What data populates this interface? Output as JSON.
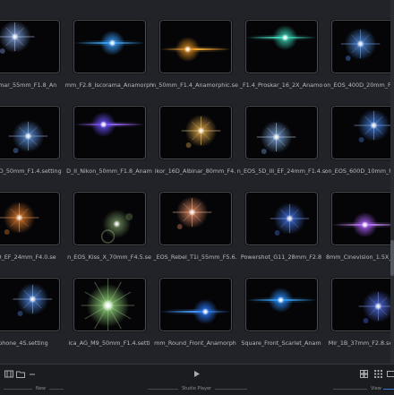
{
  "tiles": [
    {
      "caption": "ikumar_55mm_F1.8_An",
      "flare": {
        "type": "star",
        "color": "#ffffff",
        "glow": "#8fb8ff",
        "streak": "#c9d8ff"
      }
    },
    {
      "caption": "mm_F2.8_Iscorama_Anamorph",
      "flare": {
        "type": "streak",
        "color": "#d8f0ff",
        "glow": "#3aa0ff",
        "streak": "#37a8ff"
      }
    },
    {
      "caption": "n_50mm_F1.4_Anamorphic.se",
      "flare": {
        "type": "streak",
        "color": "#ffe6b0",
        "glow": "#d88a20",
        "streak": "#ffb03a"
      }
    },
    {
      "caption": "_F1.4_Proskar_16_2X_Anamo",
      "flare": {
        "type": "streak",
        "color": "#e9fff6",
        "glow": "#3ad8b8",
        "streak": "#47e0c8"
      }
    },
    {
      "caption": "on_EOS_400D_20mm_F2.8.set",
      "flare": {
        "type": "star",
        "color": "#ffffff",
        "glow": "#5aa0ff",
        "streak": "#7ab8ff"
      }
    },
    {
      "caption": "n_50D_50mm_F1.4.setting",
      "flare": {
        "type": "star",
        "color": "#ffffff",
        "glow": "#6aa8ff",
        "streak": "#a0c8ff"
      }
    },
    {
      "caption": "D_II_Nikon_50mm_F1.8_Anam",
      "flare": {
        "type": "streak",
        "color": "#f0e8ff",
        "glow": "#6a50ff",
        "streak": "#a06aff"
      }
    },
    {
      "caption": "ikor_16D_Albinar_80mm_F4.",
      "flare": {
        "type": "star",
        "color": "#fff6d0",
        "glow": "#ffbe50",
        "streak": "#ffd890"
      }
    },
    {
      "caption": "n_EOS_5D_III_EF_24mm_F1.4.s",
      "flare": {
        "type": "star",
        "color": "#ffffff",
        "glow": "#8cc0ff",
        "streak": "#d8e8ff"
      }
    },
    {
      "caption": "on_EOS_600D_10mm_F8.0.se",
      "flare": {
        "type": "star",
        "color": "#ffffff",
        "glow": "#4a90ff",
        "streak": "#a0c0ff"
      }
    },
    {
      "caption": "_7D_EF_24mm_F4.0.se",
      "flare": {
        "type": "star",
        "color": "#ffe0b0",
        "glow": "#ff8a30",
        "streak": "#ffb070"
      }
    },
    {
      "caption": "n_EOS_Kiss_X_70mm_F4.5.se",
      "flare": {
        "type": "ring",
        "color": "#ffffff",
        "glow": "#8ab070",
        "streak": "#c0d8a0"
      }
    },
    {
      "caption": "_EOS_Rebel_T1i_55mm_F5.6.",
      "flare": {
        "type": "star",
        "color": "#fff0e0",
        "glow": "#ff9a70",
        "streak": "#ffc8a0"
      }
    },
    {
      "caption": "Powershot_G11_28mm_F2.8",
      "flare": {
        "type": "star",
        "color": "#ffffff",
        "glow": "#4a80ff",
        "streak": "#90b0ff"
      }
    },
    {
      "caption": "8mm_Cinevision_1.5X_Anam",
      "flare": {
        "type": "streak",
        "color": "#f4e8ff",
        "glow": "#b060ff",
        "streak": "#d090ff"
      }
    },
    {
      "caption": "phone_4S.setting",
      "flare": {
        "type": "star",
        "color": "#ffffff",
        "glow": "#5a9aff",
        "streak": "#a8c8ff"
      }
    },
    {
      "caption": "ica_AG_M9_50mm_F1.4.setti",
      "flare": {
        "type": "burst",
        "color": "#f6fff0",
        "glow": "#9ae080",
        "streak": "#c8f0b0"
      }
    },
    {
      "caption": "mm_Round_Front_Anamorph",
      "flare": {
        "type": "streak",
        "color": "#e0f0ff",
        "glow": "#2a7aff",
        "streak": "#4a9aff"
      }
    },
    {
      "caption": "Square_Front_Scarlet_Anam",
      "flare": {
        "type": "streak",
        "color": "#e0f4ff",
        "glow": "#2a90ff",
        "streak": "#3aa8ff"
      }
    },
    {
      "caption": "Mir_1B_37mm_F2.8.setting",
      "flare": {
        "type": "star",
        "color": "#ffffff",
        "glow": "#5a7aff",
        "streak": "#8aa0ff"
      }
    }
  ],
  "bottom_bar": {
    "left_label": "New",
    "center_label": "Studio Player",
    "right_label": "View",
    "left_icons": [
      "film-icon",
      "folder-icon",
      "more-icon"
    ],
    "center_icon": "play-icon",
    "right_icons": [
      "grid-large-icon",
      "grid-small-icon",
      "list-icon"
    ]
  },
  "colors": {
    "background": "#222328",
    "accent": "#3b7ad0"
  }
}
